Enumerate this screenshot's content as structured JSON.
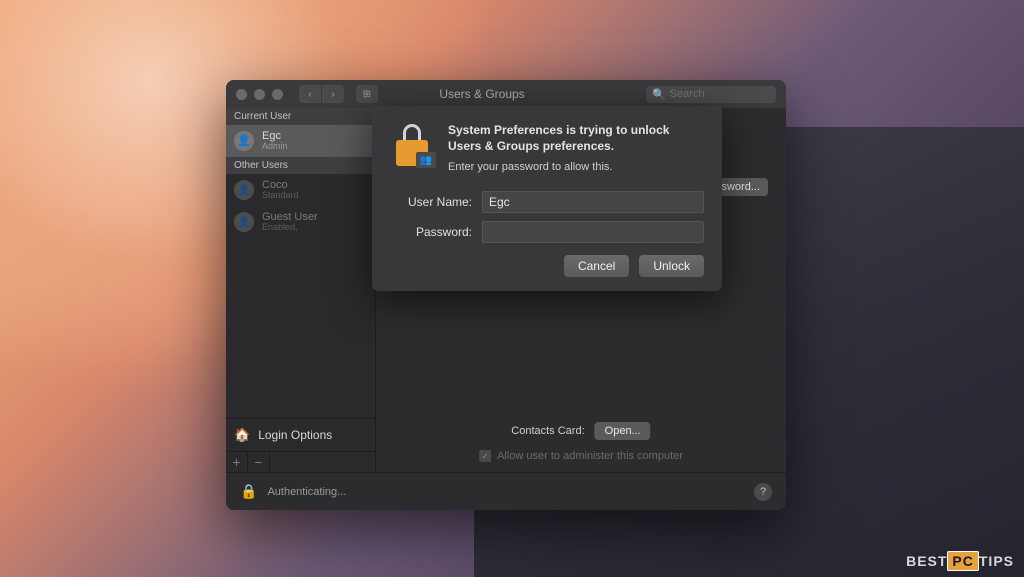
{
  "window": {
    "title": "Users & Groups",
    "search_placeholder": "Search"
  },
  "sidebar": {
    "current_user_header": "Current User",
    "other_users_header": "Other Users",
    "users": [
      {
        "name": "Egc",
        "role": "Admin",
        "selected": true
      },
      {
        "name": "Coco",
        "role": "Standard",
        "selected": false
      },
      {
        "name": "Guest User",
        "role": "Enabled,",
        "selected": false
      }
    ],
    "login_options_label": "Login Options"
  },
  "main": {
    "change_password_btn": "ssword...",
    "contacts_label": "Contacts Card:",
    "open_btn": "Open...",
    "admin_checkbox_label": "Allow user to administer this computer"
  },
  "footer": {
    "status": "Authenticating..."
  },
  "dialog": {
    "title": "System Preferences is trying to unlock Users & Groups preferences.",
    "subtitle": "Enter your password to allow this.",
    "username_label": "User Name:",
    "username_value": "Egc",
    "password_label": "Password:",
    "cancel_btn": "Cancel",
    "unlock_btn": "Unlock"
  },
  "watermark": {
    "pre": "BEST",
    "mid": "PC",
    "post": "TIPS"
  }
}
